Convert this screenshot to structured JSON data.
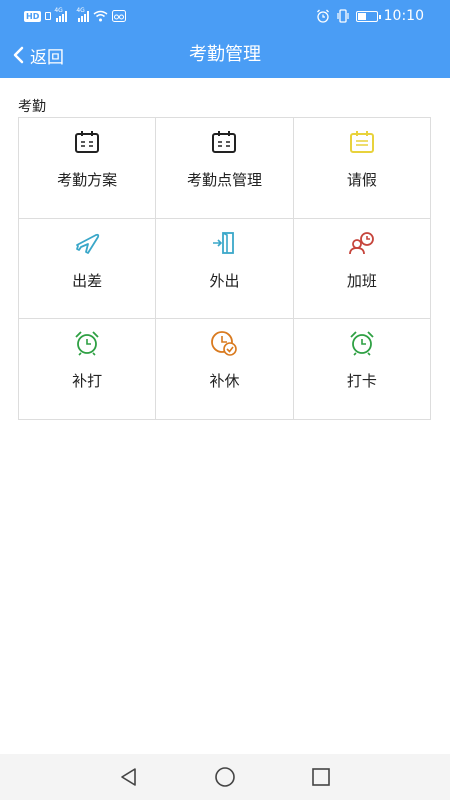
{
  "status_bar": {
    "hd_label": "HD",
    "sim1_type": "4G",
    "sim2_type": "4G",
    "time": "10:10",
    "battery_level": 0.45
  },
  "app_bar": {
    "back_label": "返回",
    "title": "考勤管理"
  },
  "section": {
    "title": "考勤"
  },
  "items": [
    {
      "label": "考勤方案",
      "icon": "calendar-icon",
      "color": "#222222"
    },
    {
      "label": "考勤点管理",
      "icon": "calendar-icon",
      "color": "#222222"
    },
    {
      "label": "请假",
      "icon": "calendar-list-icon",
      "color": "#e8d23c"
    },
    {
      "label": "出差",
      "icon": "airplane-icon",
      "color": "#3aa7c9"
    },
    {
      "label": "外出",
      "icon": "exit-door-icon",
      "color": "#3aa7c9"
    },
    {
      "label": "加班",
      "icon": "overtime-clock-icon",
      "color": "#c6453c"
    },
    {
      "label": "补打",
      "icon": "alarm-clock-icon",
      "color": "#2ea043"
    },
    {
      "label": "补休",
      "icon": "clock-check-icon",
      "color": "#d97a1f"
    },
    {
      "label": "打卡",
      "icon": "alarm-clock-icon",
      "color": "#2ea043"
    }
  ],
  "colors": {
    "primary": "#4a9df5",
    "grid_border": "#dddddd",
    "nav_bar": "#f4f4f4"
  }
}
